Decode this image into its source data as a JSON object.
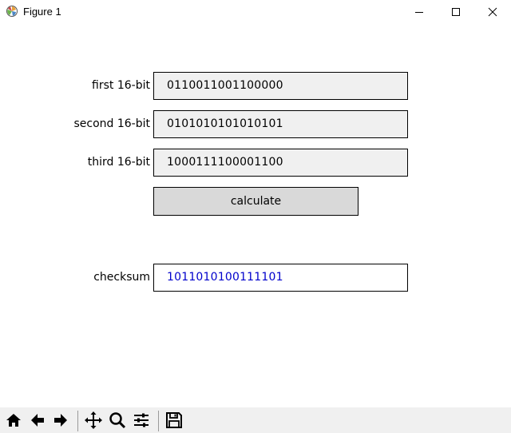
{
  "window": {
    "title": "Figure 1"
  },
  "form": {
    "first_label": "first 16-bit",
    "first_value": "0110011001100000",
    "second_label": "second 16-bit",
    "second_value": "0101010101010101",
    "third_label": "third 16-bit",
    "third_value": "1000111100001100",
    "calculate_label": "calculate",
    "checksum_label": "checksum",
    "checksum_value": "1011010100111101"
  },
  "colors": {
    "field_bg": "#f0f0f0",
    "button_bg": "#d9d9d9",
    "result_text": "#0000cc",
    "toolbar_bg": "#f0f0f0"
  },
  "toolbar": {
    "icons": [
      "home-icon",
      "back-arrow-icon",
      "forward-arrow-icon",
      "pan-icon",
      "zoom-icon",
      "configure-subplots-icon",
      "save-icon"
    ]
  }
}
